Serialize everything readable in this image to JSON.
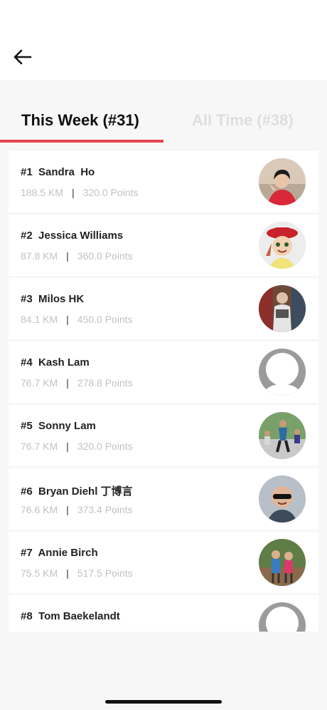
{
  "header": {
    "back_icon": "arrow-left-icon"
  },
  "tabs": [
    {
      "label": "This Week (#31)",
      "active": true
    },
    {
      "label": "All Time (#38)",
      "active": false
    }
  ],
  "accent_color": "#e8454f",
  "leaderboard": [
    {
      "rank": "#1",
      "name": "Sandra  Ho",
      "distance": "188.5 KM",
      "points": "320.0 Points"
    },
    {
      "rank": "#2",
      "name": "Jessica Williams",
      "distance": "87.8 KM",
      "points": "360.0 Points"
    },
    {
      "rank": "#3",
      "name": "Milos HK",
      "distance": "84.1 KM",
      "points": "450.0 Points"
    },
    {
      "rank": "#4",
      "name": "Kash Lam",
      "distance": "76.7 KM",
      "points": "278.8 Points"
    },
    {
      "rank": "#5",
      "name": "Sonny Lam",
      "distance": "76.7 KM",
      "points": "320.0 Points"
    },
    {
      "rank": "#6",
      "name": "Bryan Diehl 丁博言",
      "distance": "76.6 KM",
      "points": "373.4 Points"
    },
    {
      "rank": "#7",
      "name": "Annie Birch",
      "distance": "75.5 KM",
      "points": "517.5 Points"
    },
    {
      "rank": "#8",
      "name": "Tom Baekelandt",
      "distance": "",
      "points": ""
    }
  ],
  "stats_separator": "|"
}
